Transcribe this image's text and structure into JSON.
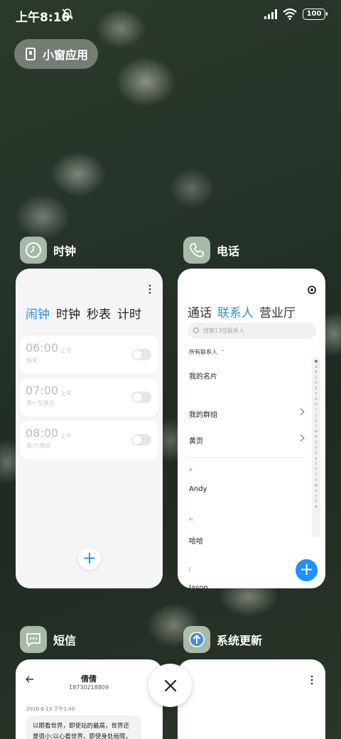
{
  "status_bar": {
    "time": "上午8:16",
    "battery": "100"
  },
  "small_window": {
    "label": "小窗应用"
  },
  "apps": {
    "clock": {
      "name": "时钟",
      "tabs": [
        "闹钟",
        "时钟",
        "秒表",
        "计时"
      ],
      "alarms": [
        {
          "time": "06:00",
          "ampm": "上午",
          "repeat": "每天"
        },
        {
          "time": "07:00",
          "ampm": "上午",
          "repeat": "周一至周五"
        },
        {
          "time": "08:00",
          "ampm": "上午",
          "repeat": "周六 周日"
        }
      ],
      "add": "+"
    },
    "phone": {
      "name": "电话",
      "tabs": [
        "通话",
        "联系人",
        "营业厅"
      ],
      "search_placeholder": "搜索13位联系人",
      "filter": "所有联系人",
      "items": [
        "我的名片",
        "我的群组",
        "黄页"
      ],
      "section_a": "A",
      "contact_a": "Andy",
      "section_h": "H",
      "contact_h": "哈哈",
      "section_j": "J",
      "contact_j": "Jason",
      "alphabet": [
        "♥",
        "A",
        "B",
        "C",
        "D",
        "E",
        "F",
        "G",
        "H",
        "I",
        "J",
        "K",
        "L",
        "M",
        "N",
        "O",
        "P",
        "Q",
        "R",
        "S",
        "T",
        "U",
        "V",
        "W",
        "X",
        "Y",
        "Z",
        "#"
      ],
      "add": "+"
    },
    "sms": {
      "name": "短信",
      "contact_name": "倩倩",
      "contact_number": "18730218809",
      "date": "2016-6-13 下午1:49",
      "message": "以眼看世界，即使站的最高，世界还是很小;以心看世界，即使身处局限，"
    },
    "update": {
      "name": "系统更新"
    }
  },
  "colors": {
    "accent": "#2e8ee6",
    "fab": "#1e90ff"
  }
}
